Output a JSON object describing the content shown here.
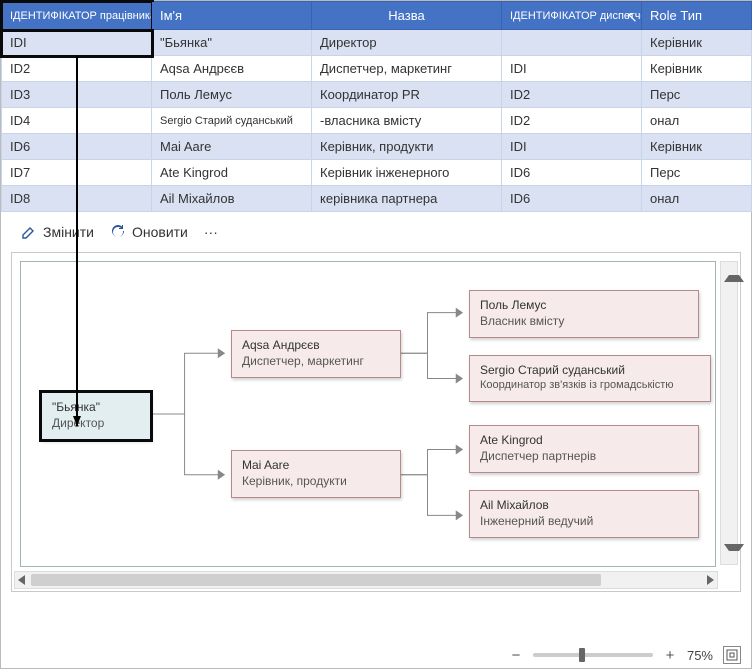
{
  "table": {
    "headers": [
      "ІДЕНТИФІКАТОР працівника",
      "Ім'я",
      "Назва",
      "ІДЕНТИФІКАТОР диспетчера",
      "Role Тип"
    ],
    "rows": [
      [
        "IDI",
        "\"Бьянка\"",
        "Директор",
        "",
        "Керівник"
      ],
      [
        "ID2",
        "Aqsa Андрєєв",
        "Диспетчер, маркетинг",
        "IDI",
        "Керівник"
      ],
      [
        "ID3",
        "Поль Лемус",
        "Координатор PR",
        "ID2",
        "Перс"
      ],
      [
        "ID4",
        "Sergio Старий суданський",
        "-власника вмісту",
        "ID2",
        "онал"
      ],
      [
        "ID6",
        "Mai Aare",
        "Керівник, продукти",
        "IDI",
        "Керівник"
      ],
      [
        "ID7",
        "Ate Kingrod",
        "Керівник інженерного",
        "ID6",
        "Перс"
      ],
      [
        "ID8",
        "Ail Міхайлов",
        "керівника партнера",
        "ID6",
        "онал"
      ]
    ]
  },
  "toolbar": {
    "edit": "Змінити",
    "refresh": "Оновити",
    "more": "···"
  },
  "org": {
    "root": {
      "name": "\"Бьянка\"",
      "title": "Директор"
    },
    "n_aqsa": {
      "name": "Aqsa Андрєєв",
      "title": "Диспетчер, маркетинг"
    },
    "n_mai": {
      "name": "Mai Aare",
      "title": "Керівник, продукти"
    },
    "n_pol": {
      "name": "Поль Лемус",
      "title": "Власник вмісту"
    },
    "n_sergio": {
      "name": "Sergio Старий суданський",
      "title": "Координатор зв'язків із громадськістю"
    },
    "n_ate": {
      "name": "Ate Kingrod",
      "title": "Диспетчер партнерів"
    },
    "n_ail": {
      "name": "Ail Міхайлов",
      "title": "Інженерний ведучий"
    }
  },
  "zoom": {
    "percent": "75%"
  }
}
